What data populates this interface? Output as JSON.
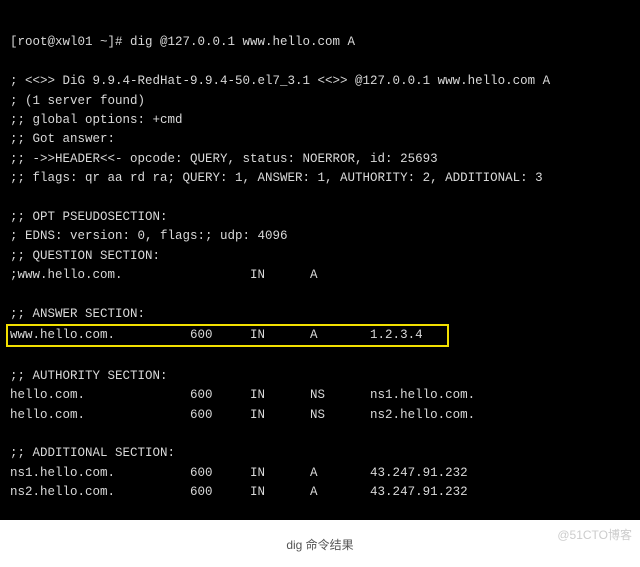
{
  "terminal": {
    "prompt": "[root@xwl01 ~]# dig @127.0.0.1 www.hello.com A",
    "blank1": "",
    "dig_version": "; <<>> DiG 9.9.4-RedHat-9.9.4-50.el7_3.1 <<>> @127.0.0.1 www.hello.com A",
    "server_found": "; (1 server found)",
    "global_opts": ";; global options: +cmd",
    "got_answer": ";; Got answer:",
    "header": ";; ->>HEADER<<- opcode: QUERY, status: NOERROR, id: 25693",
    "flags": ";; flags: qr aa rd ra; QUERY: 1, ANSWER: 1, AUTHORITY: 2, ADDITIONAL: 3",
    "blank2": "",
    "opt_header": ";; OPT PSEUDOSECTION:",
    "edns": "; EDNS: version: 0, flags:; udp: 4096",
    "question_header": ";; QUESTION SECTION:",
    "question_row": ";www.hello.com.                 IN      A",
    "blank3": "",
    "answer_header": ";; ANSWER SECTION:",
    "answer_row": "www.hello.com.          600     IN      A       1.2.3.4   ",
    "blank4": "",
    "authority_header": ";; AUTHORITY SECTION:",
    "authority_row1": "hello.com.              600     IN      NS      ns1.hello.com.",
    "authority_row2": "hello.com.              600     IN      NS      ns2.hello.com.",
    "blank5": "",
    "additional_header": ";; ADDITIONAL SECTION:",
    "additional_row1": "ns1.hello.com.          600     IN      A       43.247.91.232",
    "additional_row2": "ns2.hello.com.          600     IN      A       43.247.91.232"
  },
  "caption": "dig 命令结果",
  "watermark": "@51CTO博客",
  "chart_data": {
    "type": "table",
    "command": "dig @127.0.0.1 www.hello.com A",
    "status": "NOERROR",
    "id": 25693,
    "flags": [
      "qr",
      "aa",
      "rd",
      "ra"
    ],
    "counts": {
      "QUERY": 1,
      "ANSWER": 1,
      "AUTHORITY": 2,
      "ADDITIONAL": 3
    },
    "edns": {
      "version": 0,
      "udp": 4096
    },
    "question": [
      {
        "name": "www.hello.com.",
        "class": "IN",
        "type": "A"
      }
    ],
    "answer": [
      {
        "name": "www.hello.com.",
        "ttl": 600,
        "class": "IN",
        "type": "A",
        "data": "1.2.3.4"
      }
    ],
    "authority": [
      {
        "name": "hello.com.",
        "ttl": 600,
        "class": "IN",
        "type": "NS",
        "data": "ns1.hello.com."
      },
      {
        "name": "hello.com.",
        "ttl": 600,
        "class": "IN",
        "type": "NS",
        "data": "ns2.hello.com."
      }
    ],
    "additional": [
      {
        "name": "ns1.hello.com.",
        "ttl": 600,
        "class": "IN",
        "type": "A",
        "data": "43.247.91.232"
      },
      {
        "name": "ns2.hello.com.",
        "ttl": 600,
        "class": "IN",
        "type": "A",
        "data": "43.247.91.232"
      }
    ]
  }
}
